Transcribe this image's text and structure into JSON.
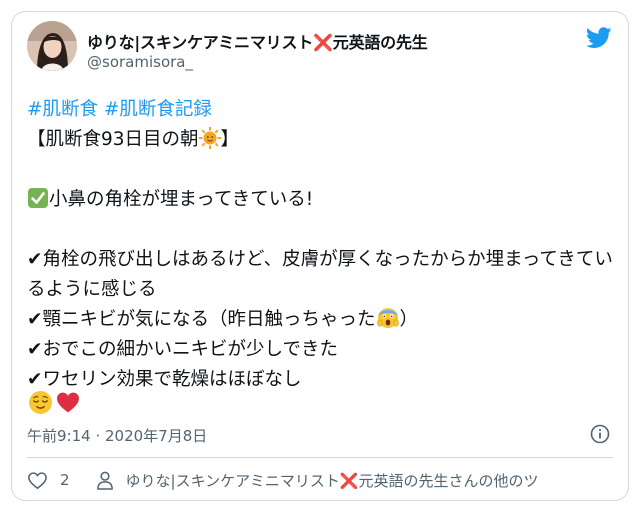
{
  "author": {
    "display_name": "ゆりな|スキンケアミニマリスト❌元英語の先生",
    "handle": "@soramisora_"
  },
  "tweet": {
    "hashtags": "#肌断食 #肌断食記録",
    "line_title": "【肌断食93日目の朝",
    "line_title_end": "】",
    "line_check": "小鼻の角栓が埋まってきている!",
    "line_1": "✔︎角栓の飛び出しはあるけど、皮膚が厚くなったからか埋まってきているように感じる",
    "line_2a": "✔︎顎ニキビが気になる（昨日触っちゃった",
    "line_2b": "）",
    "line_3": "✔︎おでこの細かいニキビが少しできた",
    "line_4": "✔︎ワセリン効果で乾燥はほぼなし"
  },
  "timestamp": "午前9:14 · 2020年7月8日",
  "footer": {
    "like_count": "2",
    "profile_link": "ゆりな|スキンケアミニマリスト❌元英語の先生さんの他のツ"
  },
  "colors": {
    "accent": "#1d9bf0",
    "text": "#0f1419",
    "muted": "#536471",
    "border": "#cfd9de",
    "heart": "#e0245e"
  },
  "icons": [
    "twitter-bird-icon",
    "info-icon",
    "heart-icon",
    "person-icon",
    "sun-emoji",
    "check-emoji",
    "scream-emoji",
    "relieved-face-emoji",
    "red-heart-emoji"
  ]
}
